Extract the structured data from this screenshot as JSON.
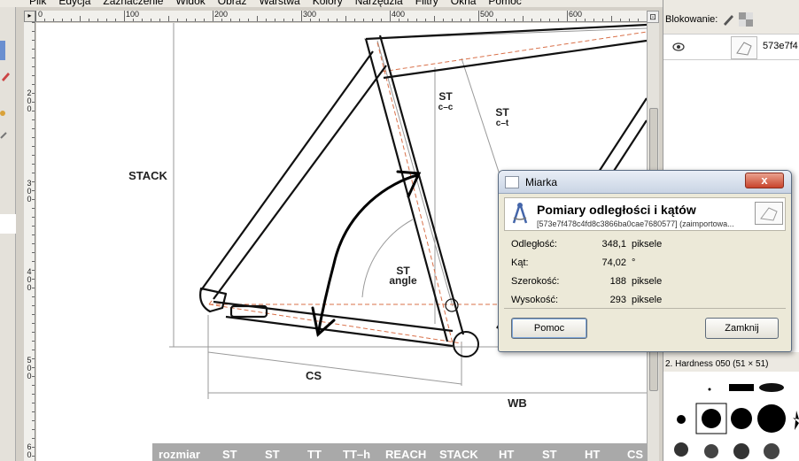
{
  "menu": [
    "Plik",
    "Edycja",
    "Zaznaczenie",
    "Widok",
    "Obraz",
    "Warstwa",
    "Kolory",
    "Narzędzia",
    "Filtry",
    "Okna",
    "Pomoc"
  ],
  "ruler": {
    "h_ticks": [
      "0",
      "100",
      "200",
      "300",
      "400",
      "500",
      "600"
    ],
    "v_ticks": [
      "2\n0\n0",
      "3\n0\n0",
      "4\n0\n0",
      "5\n0\n0",
      "6\n0"
    ]
  },
  "drawing": {
    "stack": "STACK",
    "st_cc_top": "ST",
    "st_cc_bottom": "c–c",
    "st_ct_top": "ST",
    "st_ct_bottom": "c–t",
    "st_angle_top": "ST",
    "st_angle_bottom": "angle",
    "cs": "CS",
    "wb": "WB"
  },
  "size_table": {
    "headers": [
      "rozmiar",
      "ST",
      "ST",
      "TT",
      "TT–h",
      "REACH",
      "STACK",
      "HT",
      "ST",
      "HT",
      "CS"
    ]
  },
  "dock": {
    "lock_label": "Blokowanie:",
    "layer_name": "573e7f4",
    "brush_title": "2. Hardness 050 (51 × 51)"
  },
  "dialog": {
    "title": "Miarka",
    "close_glyph": "x",
    "heading": "Pomiary odległości i kątów",
    "subheading": "[573e7f478c4fd8c3866ba0cae7680577] (zaimportowa...",
    "rows": [
      {
        "label": "Odległość:",
        "value": "348,1",
        "unit": "piksele"
      },
      {
        "label": "Kąt:",
        "value": "74,02",
        "unit": "°"
      },
      {
        "label": "Szerokość:",
        "value": "188",
        "unit": "piksele"
      },
      {
        "label": "Wysokość:",
        "value": "293",
        "unit": "piksele"
      }
    ],
    "help_button": "Pomoc",
    "close_button": "Zamknij"
  },
  "colors": {
    "dialog_bg": "#ece9d8",
    "close_red": "#c8442c",
    "table_band": "#a9a9a9"
  }
}
